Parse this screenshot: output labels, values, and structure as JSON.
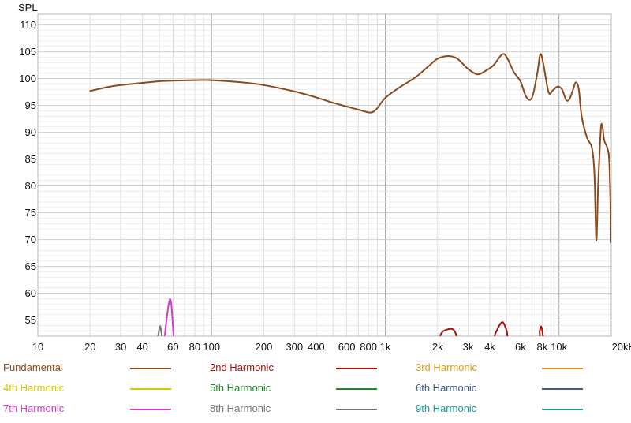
{
  "chart_data": {
    "type": "line",
    "ylabel": "SPL",
    "xscale": "log",
    "xlim": [
      10,
      20000
    ],
    "ylim": [
      52,
      112
    ],
    "x_ticks": [
      {
        "v": 10,
        "label": "10"
      },
      {
        "v": 20,
        "label": "20"
      },
      {
        "v": 30,
        "label": "30"
      },
      {
        "v": 40,
        "label": "40"
      },
      {
        "v": 60,
        "label": "60"
      },
      {
        "v": 80,
        "label": "80"
      },
      {
        "v": 100,
        "label": "100"
      },
      {
        "v": 200,
        "label": "200"
      },
      {
        "v": 300,
        "label": "300"
      },
      {
        "v": 400,
        "label": "400"
      },
      {
        "v": 600,
        "label": "600"
      },
      {
        "v": 800,
        "label": "800"
      },
      {
        "v": 1000,
        "label": "1k"
      },
      {
        "v": 2000,
        "label": "2k"
      },
      {
        "v": 3000,
        "label": "3k"
      },
      {
        "v": 4000,
        "label": "4k"
      },
      {
        "v": 6000,
        "label": "6k"
      },
      {
        "v": 8000,
        "label": "8k"
      },
      {
        "v": 10000,
        "label": "10k"
      },
      {
        "v": 20000,
        "label": "20kHz"
      }
    ],
    "y_ticks": [
      {
        "v": 55,
        "label": "55"
      },
      {
        "v": 60,
        "label": "60"
      },
      {
        "v": 65,
        "label": "65"
      },
      {
        "v": 70,
        "label": "70"
      },
      {
        "v": 75,
        "label": "75"
      },
      {
        "v": 80,
        "label": "80"
      },
      {
        "v": 85,
        "label": "85"
      },
      {
        "v": 90,
        "label": "90"
      },
      {
        "v": 95,
        "label": "95"
      },
      {
        "v": 100,
        "label": "100"
      },
      {
        "v": 105,
        "label": "105"
      },
      {
        "v": 110,
        "label": "110"
      }
    ],
    "series": [
      {
        "name": "Fundamental",
        "color": "#8b4a1c",
        "points": [
          [
            20,
            97.7
          ],
          [
            25,
            98.4
          ],
          [
            30,
            98.8
          ],
          [
            40,
            99.2
          ],
          [
            50,
            99.5
          ],
          [
            60,
            99.6
          ],
          [
            80,
            99.7
          ],
          [
            100,
            99.7
          ],
          [
            150,
            99.3
          ],
          [
            200,
            98.8
          ],
          [
            300,
            97.6
          ],
          [
            400,
            96.5
          ],
          [
            500,
            95.5
          ],
          [
            600,
            94.8
          ],
          [
            700,
            94.2
          ],
          [
            800,
            93.7
          ],
          [
            850,
            93.8
          ],
          [
            900,
            94.5
          ],
          [
            1000,
            96.4
          ],
          [
            1200,
            98.3
          ],
          [
            1500,
            100.3
          ],
          [
            1800,
            102.5
          ],
          [
            2000,
            103.7
          ],
          [
            2300,
            104.2
          ],
          [
            2600,
            103.7
          ],
          [
            3000,
            101.8
          ],
          [
            3400,
            100.8
          ],
          [
            3800,
            101.5
          ],
          [
            4200,
            102.5
          ],
          [
            4700,
            104.5
          ],
          [
            5000,
            104.0
          ],
          [
            5500,
            101.2
          ],
          [
            6000,
            99.5
          ],
          [
            6500,
            96.5
          ],
          [
            7000,
            96.5
          ],
          [
            7500,
            101.0
          ],
          [
            7800,
            104.5
          ],
          [
            8100,
            103.0
          ],
          [
            8700,
            97.5
          ],
          [
            9200,
            97.8
          ],
          [
            9800,
            98.5
          ],
          [
            10400,
            98.0
          ],
          [
            11000,
            96.0
          ],
          [
            11500,
            96.2
          ],
          [
            12000,
            97.8
          ],
          [
            12500,
            99.3
          ],
          [
            13000,
            98.0
          ],
          [
            13500,
            93.0
          ],
          [
            14500,
            89.0
          ],
          [
            15500,
            87.0
          ],
          [
            16000,
            82.0
          ],
          [
            16400,
            69.8
          ],
          [
            16800,
            80.0
          ],
          [
            17400,
            90.5
          ],
          [
            17800,
            91.0
          ],
          [
            18200,
            88.5
          ],
          [
            19000,
            87.0
          ],
          [
            19500,
            84.0
          ],
          [
            20000,
            69.5
          ]
        ]
      },
      {
        "name": "2nd Harmonic",
        "color": "#a81010",
        "points": [
          [
            2000,
            50
          ],
          [
            2100,
            52.5
          ],
          [
            2300,
            53.3
          ],
          [
            2500,
            53.0
          ],
          [
            2800,
            50
          ],
          [
            4000,
            50
          ],
          [
            4300,
            52.5
          ],
          [
            4700,
            54.6
          ],
          [
            5000,
            53.0
          ],
          [
            5300,
            50
          ],
          [
            7500,
            50
          ],
          [
            7750,
            53.0
          ],
          [
            7900,
            53.8
          ],
          [
            8050,
            52.5
          ],
          [
            8200,
            50
          ]
        ]
      },
      {
        "name": "3rd Harmonic",
        "color": "#e29a16",
        "points": []
      },
      {
        "name": "4th Harmonic",
        "color": "#d8c600",
        "points": []
      },
      {
        "name": "5th Harmonic",
        "color": "#208a2a",
        "points": []
      },
      {
        "name": "6th Harmonic",
        "color": "#3d5e86",
        "points": []
      },
      {
        "name": "7th Harmonic",
        "color": "#d53ac8",
        "points": [
          [
            53,
            50
          ],
          [
            55,
            55.0
          ],
          [
            57,
            58.4
          ],
          [
            58,
            58.8
          ],
          [
            59,
            57.0
          ],
          [
            61,
            50
          ]
        ]
      },
      {
        "name": "8th Harmonic",
        "color": "#777777",
        "points": [
          [
            48,
            50
          ],
          [
            49.5,
            52.5
          ],
          [
            50.5,
            53.9
          ],
          [
            51.5,
            52.5
          ],
          [
            53,
            50
          ]
        ]
      },
      {
        "name": "9th Harmonic",
        "color": "#1a9c96",
        "points": []
      }
    ]
  }
}
